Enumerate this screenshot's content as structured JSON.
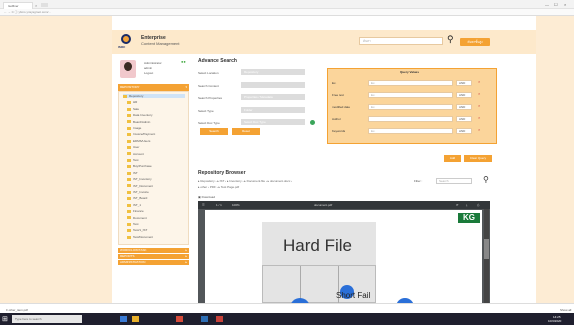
{
  "browser": {
    "tab_title": "Isolfiner",
    "url": "← → C   ⓘ ybms.ynsysgroot.com/..."
  },
  "header": {
    "logo_text": "ISOC",
    "title": "Enterprise",
    "subtitle": "Content Management",
    "search_placeholder": "ค้นหา",
    "advance_button": "ค้นหาขั้นสูง"
  },
  "sidebar": {
    "user_lines": [
      "Administrator",
      "admin",
      "Logout"
    ],
    "repository_label": "REPOSITORY",
    "tree": [
      "Repository",
      "HR",
      "Sale",
      "Data Inventory",
      "Board/Admin",
      "Image",
      "Invoice/Payment",
      "EDMS/Users",
      "User",
      "Account",
      "Test",
      "Buy/Purchase",
      "IST",
      "IST_Inventory",
      "IST_Document",
      "IST_Invoice",
      "IST_Board",
      "IST_1",
      "Finance",
      "Document",
      "Test",
      "Test/1_IST",
      "Test/Document"
    ],
    "sections": [
      "WORKFLOW/TASK",
      "REPORTS",
      "ADMINISTRATION"
    ]
  },
  "advance_search": {
    "title": "Advance Search",
    "fields": [
      {
        "label": "Select Location",
        "value": "Repository"
      },
      {
        "label": "Search Content",
        "value": ""
      },
      {
        "label": "Search Properties",
        "value": "Properties / Metadata"
      },
      {
        "label": "Select Type",
        "value": "Folder"
      },
      {
        "label": "Select Doc Type",
        "value": "Select Doc Type"
      }
    ],
    "search_button": "Search",
    "reset_button": "Reset",
    "query_values": {
      "title": "Query Values",
      "rows": [
        {
          "label": "Ex.",
          "placeholder": "Ex.",
          "op": "AND"
        },
        {
          "label": "Free text",
          "placeholder": "Ex.",
          "op": "AND"
        },
        {
          "label": "modified date",
          "placeholder": "Ex.",
          "op": "AND"
        },
        {
          "label": "Author",
          "placeholder": "",
          "op": "AND"
        },
        {
          "label": "Keywords",
          "placeholder": "Ex.",
          "op": "AND"
        }
      ]
    },
    "add_button": "Add",
    "clear_all_button": "Clear Query"
  },
  "repository_browser": {
    "title": "Repository Browser",
    "path_line1": "▸ Repository › ▸ IST › ▸ Inventory › ▸ Document.file › ▸ document.docx ›",
    "path_line2": "▸ other › PDF › ▸ Test Page.pdf",
    "filter_label": "Filter :",
    "filter_placeholder": "Search",
    "download_label": "▣ Download",
    "viewer_toolbar": {
      "page": "1 / 1",
      "zoom": "100%",
      "filename": "document.pdf"
    },
    "page": {
      "brand": "KG",
      "heading": "Hard File",
      "subheading": "Short Fail"
    }
  },
  "bottom": {
    "download_item": "≡ other_item.pdf",
    "show_all": "Show all",
    "taskbar_search": "Type here to search",
    "time": "14:25",
    "date": "10/3/2020"
  },
  "colors": {
    "accent": "#f4a233",
    "page_bg": "#fdecd4",
    "query_panel": "#fbd59b"
  }
}
